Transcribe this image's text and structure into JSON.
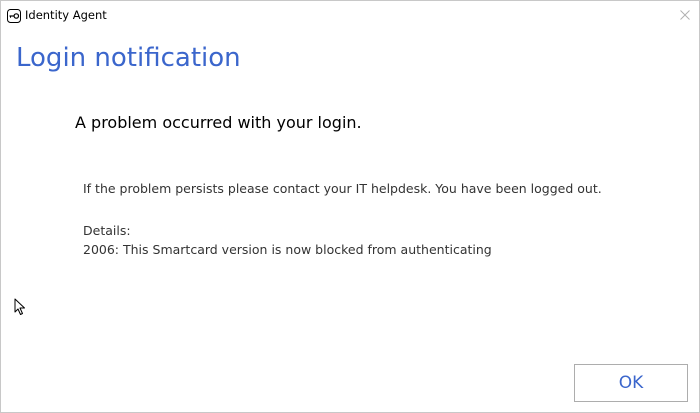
{
  "window": {
    "title": "Identity Agent",
    "app_icon": "key-icon",
    "close_icon": "close-icon"
  },
  "main": {
    "heading": "Login notification",
    "subheading": "A problem occurred with your login.",
    "message": "If the problem persists please contact your IT helpdesk.  You have been logged out.",
    "details_label": "Details:",
    "details_text": "2006: This Smartcard version is now blocked from authenticating"
  },
  "footer": {
    "ok_label": "OK"
  },
  "colors": {
    "accent": "#3b66cc",
    "text": "#333333",
    "border": "#adadad"
  }
}
